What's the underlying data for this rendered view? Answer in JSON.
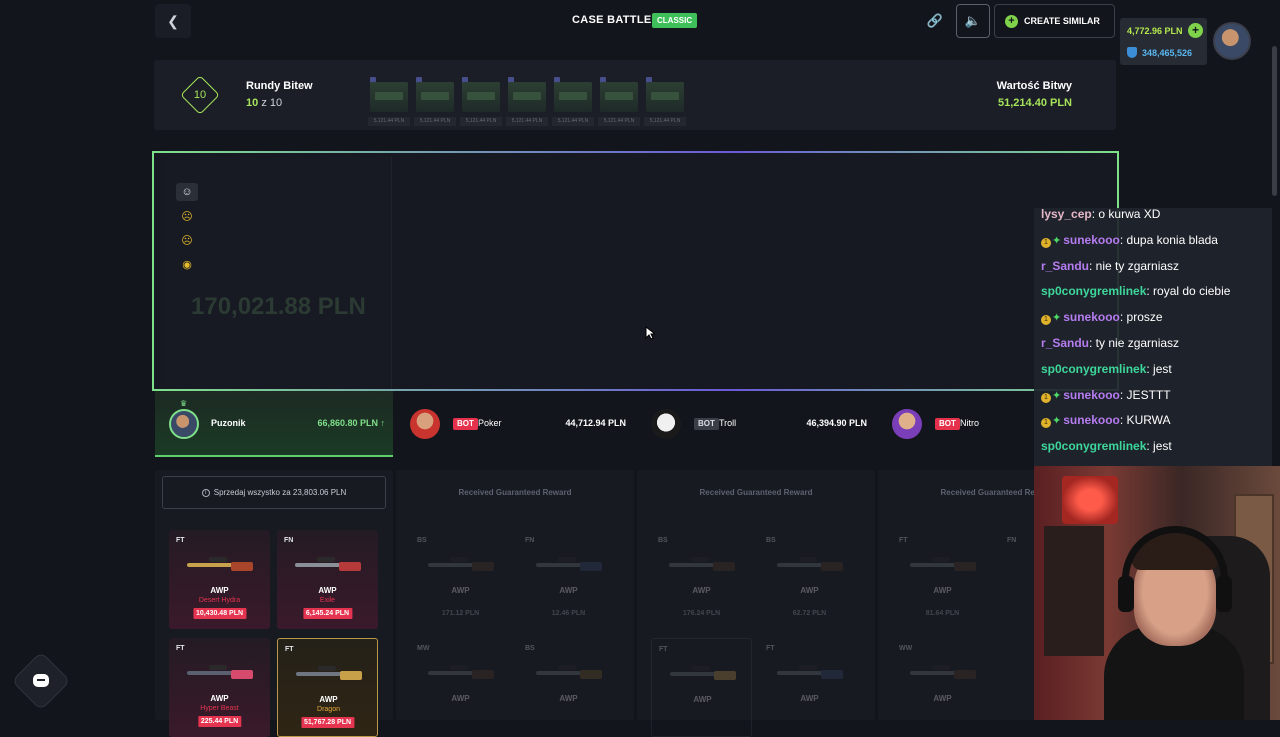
{
  "header": {
    "title": "CASE BATTLE",
    "mode_badge": "CLASSIC",
    "create_similar": "CREATE SIMILAR",
    "balance": "4,772.96 PLN",
    "points": "348,465,526"
  },
  "rounds": {
    "label": "Rundy Bitew",
    "current": "10",
    "of": "z 10",
    "badge": "10",
    "battle_value_label": "Wartość Bitwy",
    "battle_value": "51,214.40 PLN",
    "case_prices": [
      "5,121.44 PLN",
      "5,121.44 PLN",
      "5,121.44 PLN",
      "5,121.44 PLN",
      "5,121.44 PLN",
      "5,121.44 PLN",
      "5,121.44 PLN"
    ]
  },
  "arena": {
    "ghost_value": "170,021.88 PLN",
    "emojis": [
      "neutral-face-icon",
      "frowning-face-icon",
      "sad-face-icon",
      "astonished-face-icon"
    ]
  },
  "players": [
    {
      "name": "Puzonik",
      "value": "66,860.80 PLN",
      "bot": false
    },
    {
      "name": "Poker",
      "value": "44,712.94 PLN",
      "bot": true,
      "bot_label": "BOT"
    },
    {
      "name": "Troll",
      "value": "46,394.90 PLN",
      "bot": true,
      "bot_label": "BOT"
    },
    {
      "name": "Nitro",
      "value": "",
      "bot": true,
      "bot_label": "BOT"
    }
  ],
  "rewards": {
    "sell_all": "Sprzedaj wszystko za 23,803.06 PLN",
    "guaranteed": "Received Guaranteed Reward",
    "col1_items": [
      {
        "cond": "FT",
        "name": "AWP",
        "skin": "Desert Hydra",
        "price": "10,430.48 PLN"
      },
      {
        "cond": "FN",
        "name": "AWP",
        "skin": "Exile",
        "price": "6,145.24 PLN"
      },
      {
        "cond": "FT",
        "name": "AWP",
        "skin": "Hyper Beast",
        "price": "225.44 PLN"
      },
      {
        "cond": "FT",
        "name": "AWP",
        "skin": "Dragon",
        "price": "51,767.28 PLN"
      }
    ],
    "col2_items": [
      {
        "cond": "BS",
        "name": "AWP",
        "price": "171.12 PLN"
      },
      {
        "cond": "FN",
        "name": "AWP",
        "price": "12.46 PLN"
      },
      {
        "cond": "MW",
        "name": "AWP",
        "price": ""
      },
      {
        "cond": "BS",
        "name": "AWP",
        "price": ""
      }
    ],
    "col3_items": [
      {
        "cond": "BS",
        "name": "AWP",
        "price": "176.24 PLN"
      },
      {
        "cond": "BS",
        "name": "AWP",
        "price": "62.72 PLN"
      },
      {
        "cond": "FT",
        "name": "AWP",
        "price": ""
      },
      {
        "cond": "FT",
        "name": "AWP",
        "price": ""
      }
    ],
    "col4_items": [
      {
        "cond": "FT",
        "name": "AWP",
        "price": "81.64 PLN"
      },
      {
        "cond": "FN",
        "name": "AWP",
        "price": ""
      },
      {
        "cond": "WW",
        "name": "AWP",
        "price": ""
      },
      {
        "cond": "FT",
        "name": "AWP",
        "price": ""
      }
    ]
  },
  "chat": [
    {
      "user": "lysy_cep",
      "text": ": o kurwa XD",
      "color": "pink",
      "badge": false
    },
    {
      "user": "sunekooo",
      "text": ": dupa konia blada",
      "color": "purple",
      "badge": true
    },
    {
      "user": "r_Sandu",
      "text": ": nie ty zgarniasz",
      "color": "purple",
      "badge": false
    },
    {
      "user": "sp0conygremlinek",
      "text": ": royal do ciebie",
      "color": "green",
      "badge": false
    },
    {
      "user": "sunekooo",
      "text": ": prosze",
      "color": "purple",
      "badge": true
    },
    {
      "user": "r_Sandu",
      "text": ": ty nie zgarniasz",
      "color": "purple",
      "badge": false
    },
    {
      "user": "sp0conygremlinek",
      "text": ": jest",
      "color": "green",
      "badge": false
    },
    {
      "user": "sunekooo",
      "text": ": JESTTT",
      "color": "purple",
      "badge": true
    },
    {
      "user": "sunekooo",
      "text": ": KURWA",
      "color": "purple",
      "badge": true
    },
    {
      "user": "sp0conygremlinek",
      "text": ": jest",
      "color": "green",
      "badge": false
    }
  ],
  "colors": {
    "accent_green": "#a6e35a",
    "bot_red": "#e5314b",
    "price_red": "#e4344f"
  }
}
